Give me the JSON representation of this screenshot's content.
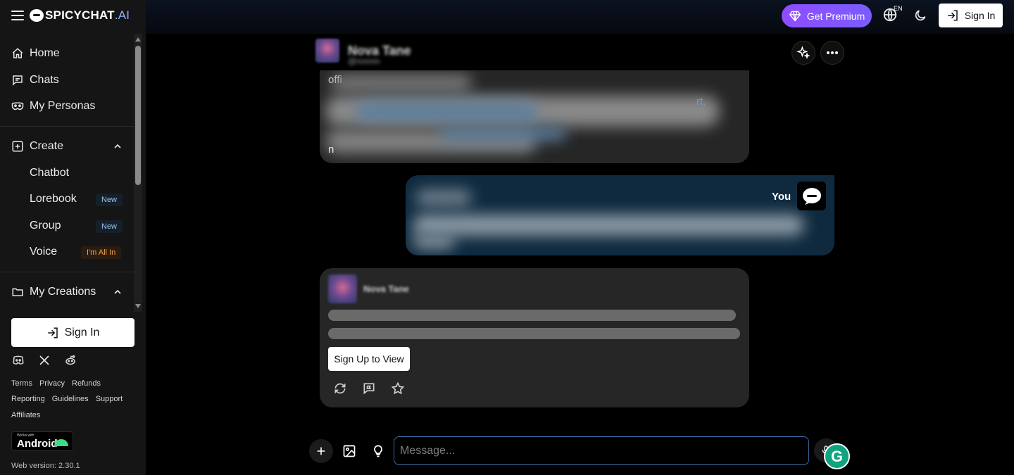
{
  "brand": {
    "name": "SPICYCHAT",
    "suffix": ".AI"
  },
  "sidebar": {
    "nav": [
      {
        "label": "Home",
        "icon": "home-icon"
      },
      {
        "label": "Chats",
        "icon": "chat-icon"
      },
      {
        "label": "My Personas",
        "icon": "mask-icon"
      }
    ],
    "create": {
      "label": "Create",
      "items": [
        {
          "label": "Chatbot"
        },
        {
          "label": "Lorebook",
          "badge": "New"
        },
        {
          "label": "Group",
          "badge": "New"
        },
        {
          "label": "Voice",
          "badge": "I'm All In"
        }
      ]
    },
    "my_creations": {
      "label": "My Creations"
    },
    "sign_in_label": "Sign In",
    "social_icons": [
      "discord-icon",
      "x-icon",
      "reddit-icon"
    ],
    "footer_row1": [
      "Terms",
      "Privacy",
      "Refunds"
    ],
    "footer_row2": [
      "Reporting",
      "Guidelines",
      "Support"
    ],
    "footer_row3": [
      "Affiliates"
    ],
    "android_badge": {
      "small": "Works with",
      "text": "Android"
    },
    "version": "Web version: 2.30.1"
  },
  "topbar": {
    "premium_label": "Get Premium",
    "language_code": "EN",
    "sign_in_label": "Sign In"
  },
  "chat": {
    "character_name": "Nova Tane",
    "character_sub": "@nnnnn",
    "bot_message_fragment_start": "offi",
    "bot_message_fragment_end": "rt,",
    "bot_message_fragment_last": "n",
    "user_label": "You",
    "second_bot_name": "Nova Tane",
    "signup_view_label": "Sign Up to View",
    "message_placeholder": "Message..."
  },
  "colors": {
    "premium_gradient_start": "#8f4dff",
    "premium_gradient_end": "#7a5cff",
    "user_bubble": "#0f2a3f",
    "bot_bubble": "#262626",
    "input_border": "#3b6ea8",
    "grammarly": "#0fa380"
  }
}
